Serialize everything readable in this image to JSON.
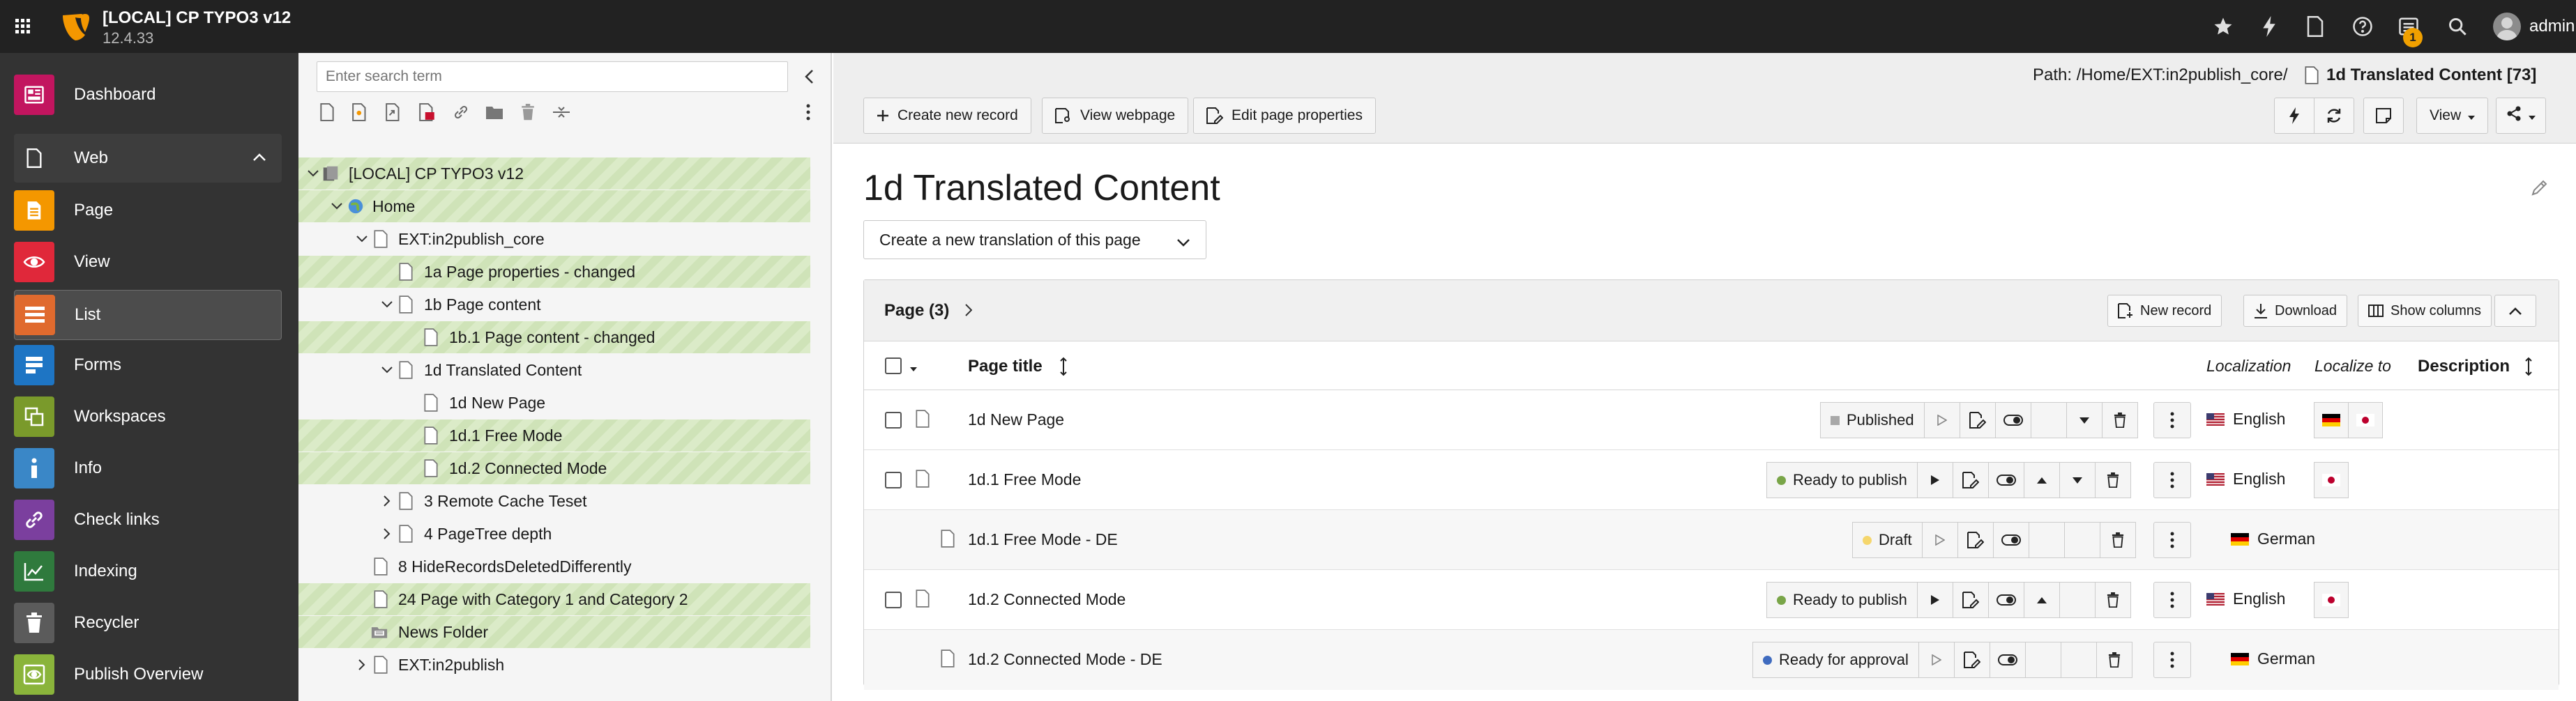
{
  "topbar": {
    "site_name": "[LOCAL] CP TYPO3 v12",
    "version": "12.4.33",
    "badge_count": "1",
    "user": "admin",
    "icons": [
      "app-grid-icon",
      "bookmark-star-icon",
      "flash-icon",
      "document-icon",
      "help-icon",
      "system-info-icon",
      "search-icon",
      "user-avatar-icon"
    ]
  },
  "modules": {
    "dashboard": "Dashboard",
    "web_group": "Web",
    "page": "Page",
    "view": "View",
    "list": "List",
    "forms": "Forms",
    "workspaces": "Workspaces",
    "info": "Info",
    "check_links": "Check links",
    "indexing": "Indexing",
    "recycler": "Recycler",
    "publish_overview": "Publish Overview"
  },
  "tree": {
    "search_placeholder": "Enter search term",
    "nodes": [
      "[LOCAL] CP TYPO3 v12",
      "Home",
      "EXT:in2publish_core",
      "1a Page properties - changed",
      "1b Page content",
      "1b.1 Page content - changed",
      "1d Translated Content",
      "1d New Page",
      "1d.1 Free Mode",
      "1d.2 Connected Mode",
      "3 Remote Cache Teset",
      "4 PageTree depth",
      "8 HideRecordsDeletedDifferently",
      "24 Page with Category 1 and Category 2",
      "News Folder",
      "EXT:in2publish"
    ]
  },
  "docheader": {
    "create_new_record": "Create new record",
    "view_webpage": "View webpage",
    "edit_page_properties": "Edit page properties",
    "view_dropdown": "View",
    "path_label": "Path: /Home/EXT:in2publish_core/",
    "path_title": "1d Translated Content [73]"
  },
  "main": {
    "heading": "1d Translated Content",
    "translation_select": "Create a new translation of this page"
  },
  "panel": {
    "title": "Page (3)",
    "new_record": "New record",
    "download": "Download",
    "show_columns": "Show columns",
    "columns": {
      "page_title": "Page title",
      "localization": "Localization",
      "localize_to": "Localize to",
      "description": "Description"
    },
    "rows": [
      {
        "title": "1d New Page",
        "status": "Published",
        "status_color": "#a8a8a8",
        "language": "English"
      },
      {
        "title": "1d.1 Free Mode",
        "status": "Ready to publish",
        "status_color": "#79a548",
        "language": "English"
      },
      {
        "title": "1d.1 Free Mode - DE",
        "status": "Draft",
        "status_color": "#f5d66c",
        "language": "German"
      },
      {
        "title": "1d.2 Connected Mode",
        "status": "Ready to publish",
        "status_color": "#79a548",
        "language": "English"
      },
      {
        "title": "1d.2 Connected Mode - DE",
        "status": "Ready for approval",
        "status_color": "#3f6bbf",
        "language": "German"
      }
    ]
  },
  "colors": {
    "topbar": "#222222",
    "module_menu": "#333333",
    "typo3_orange": "#f49700",
    "changed_stripe": "#cfe3b8"
  }
}
